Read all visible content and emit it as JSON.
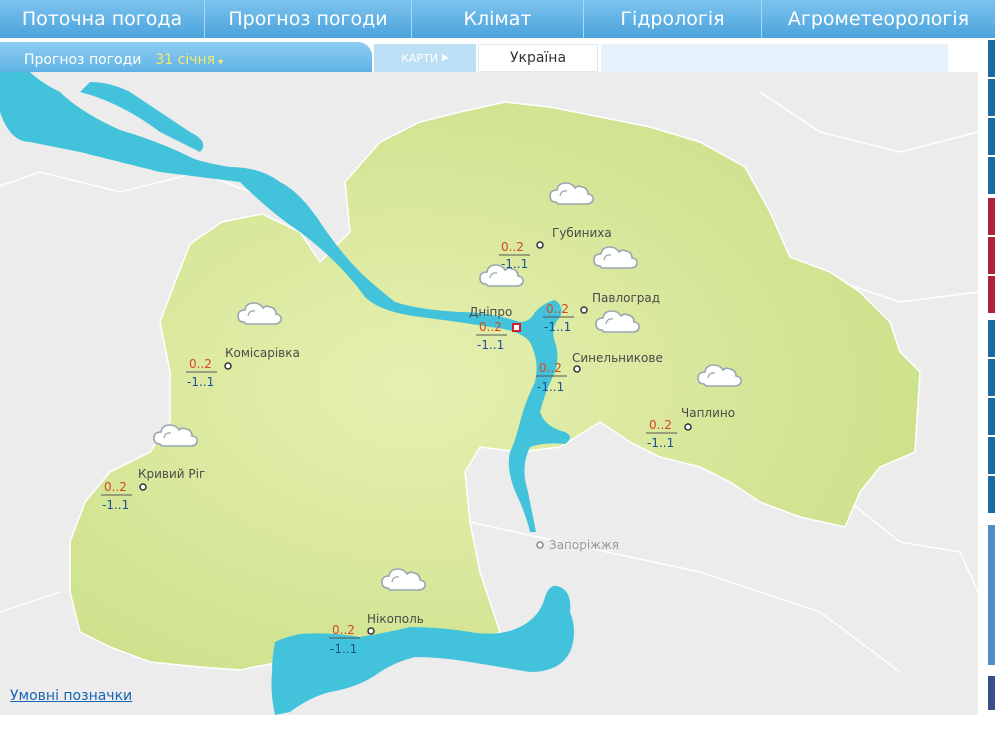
{
  "nav": {
    "tabs": [
      {
        "label": "Поточна погода"
      },
      {
        "label": "Прогноз погоди"
      },
      {
        "label": "Клімат"
      },
      {
        "label": "Гідрологія"
      },
      {
        "label": "Агрометеорологія"
      }
    ]
  },
  "subbar": {
    "forecast_label": "Прогноз погоди",
    "date": "31 січня",
    "maps_button": "КАРТИ",
    "region": "Україна"
  },
  "legend_link": "Умовні позначки",
  "cities": [
    {
      "name": "Губиниха",
      "tmax": "0..2",
      "tmin": "-1..1",
      "weather_icon": "cloudy-icon"
    },
    {
      "name": "Дніпро",
      "tmax": "0..2",
      "tmin": "-1..1",
      "weather_icon": "cloudy-icon",
      "capital": true
    },
    {
      "name": "Павлоград",
      "tmax": "0..2",
      "tmin": "-1..1",
      "weather_icon": "cloudy-icon"
    },
    {
      "name": "Синельникове",
      "tmax": "0..2",
      "tmin": "-1..1",
      "weather_icon": "cloudy-icon"
    },
    {
      "name": "Комісарівка",
      "tmax": "0..2",
      "tmin": "-1..1",
      "weather_icon": "cloudy-icon"
    },
    {
      "name": "Чаплино",
      "tmax": "0..2",
      "tmin": "-1..1",
      "weather_icon": "cloudy-icon"
    },
    {
      "name": "Кривий Ріг",
      "tmax": "0..2",
      "tmin": "-1..1",
      "weather_icon": "cloudy-icon"
    },
    {
      "name": "Нікополь",
      "tmax": "0..2",
      "tmin": "-1..1",
      "weather_icon": "cloudy-icon"
    },
    {
      "name": "Запоріжжя",
      "outside_region": true
    }
  ],
  "colors": {
    "region_fill": "#d7e89a",
    "water": "#43c3db",
    "nav_blue": "#5aaee2",
    "temp_max": "#d24a1e",
    "temp_min": "#1a4f9a"
  }
}
